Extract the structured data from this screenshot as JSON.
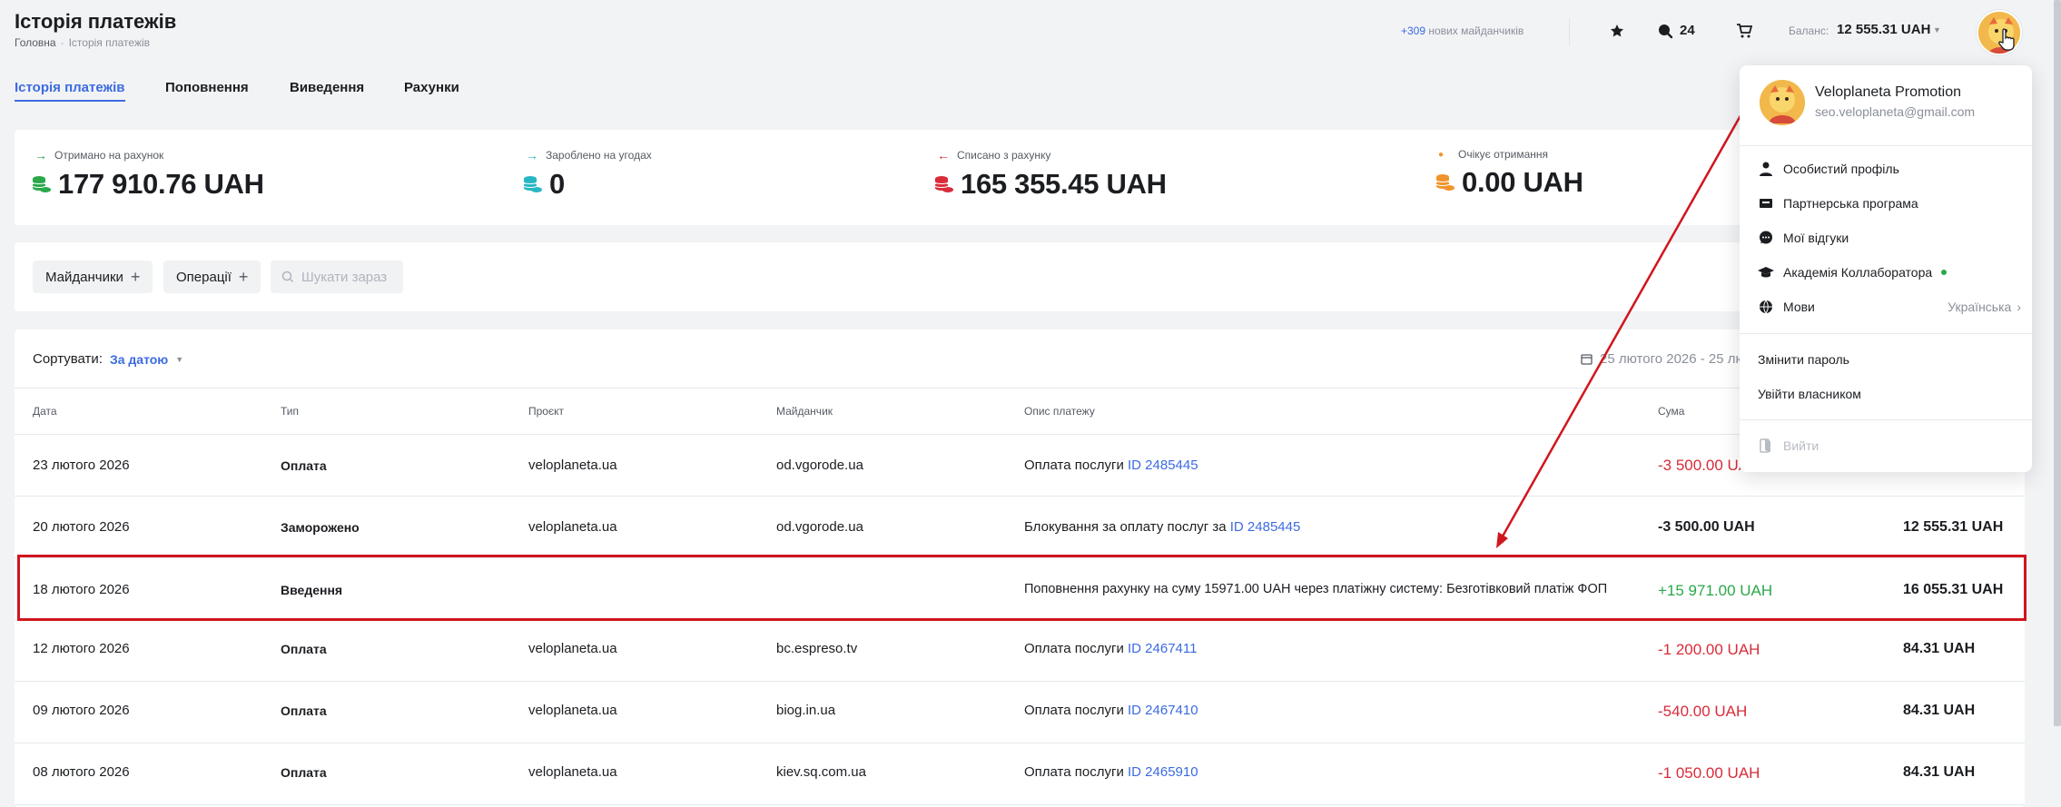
{
  "header": {
    "title": "Історія платежів",
    "breadcrumb": {
      "home": "Головна",
      "current": "Історія платежів"
    },
    "new_sites_count": "+309",
    "new_sites_label": "нових майданчиків",
    "notifications_count": "24",
    "balance_label": "Баланс:",
    "balance_value": "12 555.31 UAH"
  },
  "tabs": [
    {
      "label": "Історія платежів",
      "active": true
    },
    {
      "label": "Поповнення"
    },
    {
      "label": "Виведення"
    },
    {
      "label": "Рахунки"
    }
  ],
  "stats": [
    {
      "label": "Отримано на рахунок",
      "value": "177 910.76 UAH",
      "color": "#2aa84a",
      "arrow": "→"
    },
    {
      "label": "Зароблено на угодах",
      "value": "0",
      "color": "#27b6c4",
      "arrow": "→"
    },
    {
      "label": "Списано з рахунку",
      "value": "165 355.45 UAH",
      "color": "#d92b3a",
      "arrow": "←"
    },
    {
      "label": "Очікує отримання",
      "value": "0.00 UAH",
      "color": "#f0932b",
      "arrow": "●"
    }
  ],
  "filters": {
    "sites_label": "Майданчики",
    "operations_label": "Операції",
    "search_placeholder": "Шукати зараз"
  },
  "table": {
    "sort_label": "Сортувати:",
    "sort_value": "За датою",
    "date_range": "25 лютого 2026 - 25 лю",
    "columns": [
      "Дата",
      "Тип",
      "Проєкт",
      "Майданчик",
      "Опис платежу",
      "Сума"
    ],
    "rows": [
      {
        "date": "23 лютого 2026",
        "type": "Оплата",
        "project": "veloplaneta.ua",
        "site": "od.vgorode.ua",
        "desc": "Оплата послуги ",
        "link": "ID 2485445",
        "amount": "-3 500.00 UAH",
        "amount_kind": "neg",
        "balance": ""
      },
      {
        "date": "20 лютого 2026",
        "type": "Заморожено",
        "project": "veloplaneta.ua",
        "site": "od.vgorode.ua",
        "desc": "Блокування за оплату послуг за ",
        "link": "ID 2485445",
        "amount": "-3 500.00 UAH",
        "amount_kind": "neutral",
        "balance": "12 555.31 UAH"
      },
      {
        "date": "18 лютого 2026",
        "type": "Введення",
        "project": "",
        "site": "",
        "desc": "Поповнення рахунку на суму 15971.00 UAH через платіжну систему: Безготівковий платіж ФОП",
        "link": "",
        "amount": "+15 971.00 UAH",
        "amount_kind": "pos",
        "balance": "16 055.31 UAH"
      },
      {
        "date": "12 лютого 2026",
        "type": "Оплата",
        "project": "veloplaneta.ua",
        "site": "bc.espreso.tv",
        "desc": "Оплата послуги ",
        "link": "ID 2467411",
        "amount": "-1 200.00 UAH",
        "amount_kind": "neg",
        "balance": "84.31 UAH"
      },
      {
        "date": "09 лютого 2026",
        "type": "Оплата",
        "project": "veloplaneta.ua",
        "site": "biog.in.ua",
        "desc": "Оплата послуги ",
        "link": "ID 2467410",
        "amount": "-540.00 UAH",
        "amount_kind": "neg",
        "balance": "84.31 UAH"
      },
      {
        "date": "08 лютого 2026",
        "type": "Оплата",
        "project": "veloplaneta.ua",
        "site": "kiev.sq.com.ua",
        "desc": "Оплата послуги ",
        "link": "ID 2465910",
        "amount": "-1 050.00 UAH",
        "amount_kind": "neg",
        "balance": "84.31 UAH"
      }
    ]
  },
  "dropdown": {
    "name": "Veloplaneta Promotion",
    "email": "seo.veloplaneta@gmail.com",
    "items": [
      {
        "label": "Особистий профіль",
        "icon": "person-icon"
      },
      {
        "label": "Партнерська програма",
        "icon": "partner-icon"
      },
      {
        "label": "Мої відгуки",
        "icon": "chat-icon"
      },
      {
        "label": "Академія Коллаборатора",
        "icon": "graduation-cap-icon"
      },
      {
        "label": "Мови",
        "icon": "globe-icon",
        "value": "Українська"
      }
    ],
    "change_password": "Змінити пароль",
    "login_as_owner": "Увійти власником",
    "logout": "Вийти"
  },
  "colors": {
    "accent": "#3c6be0",
    "negative": "#d92b3a",
    "positive": "#2aa84a",
    "annotation": "#d0161d"
  }
}
